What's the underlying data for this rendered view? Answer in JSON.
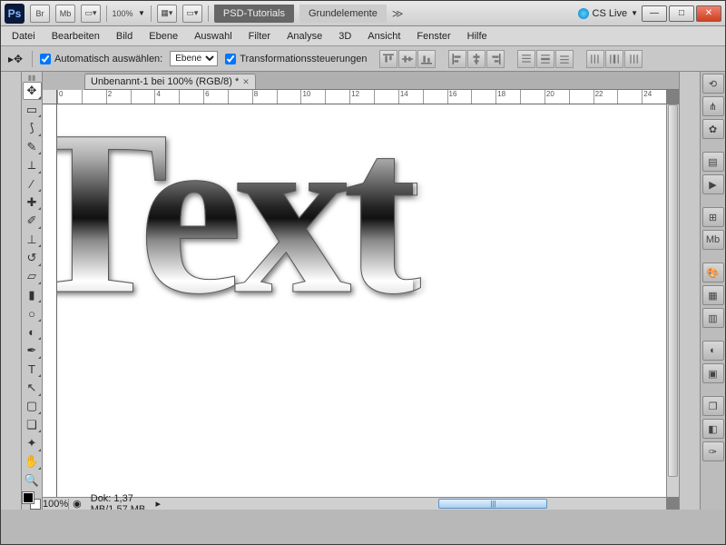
{
  "titlebar": {
    "zoom": "100%",
    "app_tabs": [
      "PSD-Tutorials",
      "Grundelemente"
    ],
    "cs_live": "CS Live",
    "ps": "Ps",
    "br": "Br",
    "mb": "Mb"
  },
  "menu": [
    "Datei",
    "Bearbeiten",
    "Bild",
    "Ebene",
    "Auswahl",
    "Filter",
    "Analyse",
    "3D",
    "Ansicht",
    "Fenster",
    "Hilfe"
  ],
  "options": {
    "auto_select": "Automatisch auswählen:",
    "layer_mode": "Ebene",
    "transform": "Transformationssteuerungen"
  },
  "doc_tab": "Unbenannt-1 bei 100% (RGB/8) *",
  "ruler_ticks": [
    "0",
    "",
    "2",
    "",
    "4",
    "",
    "6",
    "",
    "8",
    "",
    "10",
    "",
    "12",
    "",
    "14",
    "",
    "16",
    "",
    "18",
    "",
    "20",
    "",
    "22",
    "",
    "24"
  ],
  "canvas_text": "Text",
  "status": {
    "zoom": "100%",
    "doksize": "Dok: 1,37 MB/1,57 MB"
  },
  "hthumb": "|||"
}
